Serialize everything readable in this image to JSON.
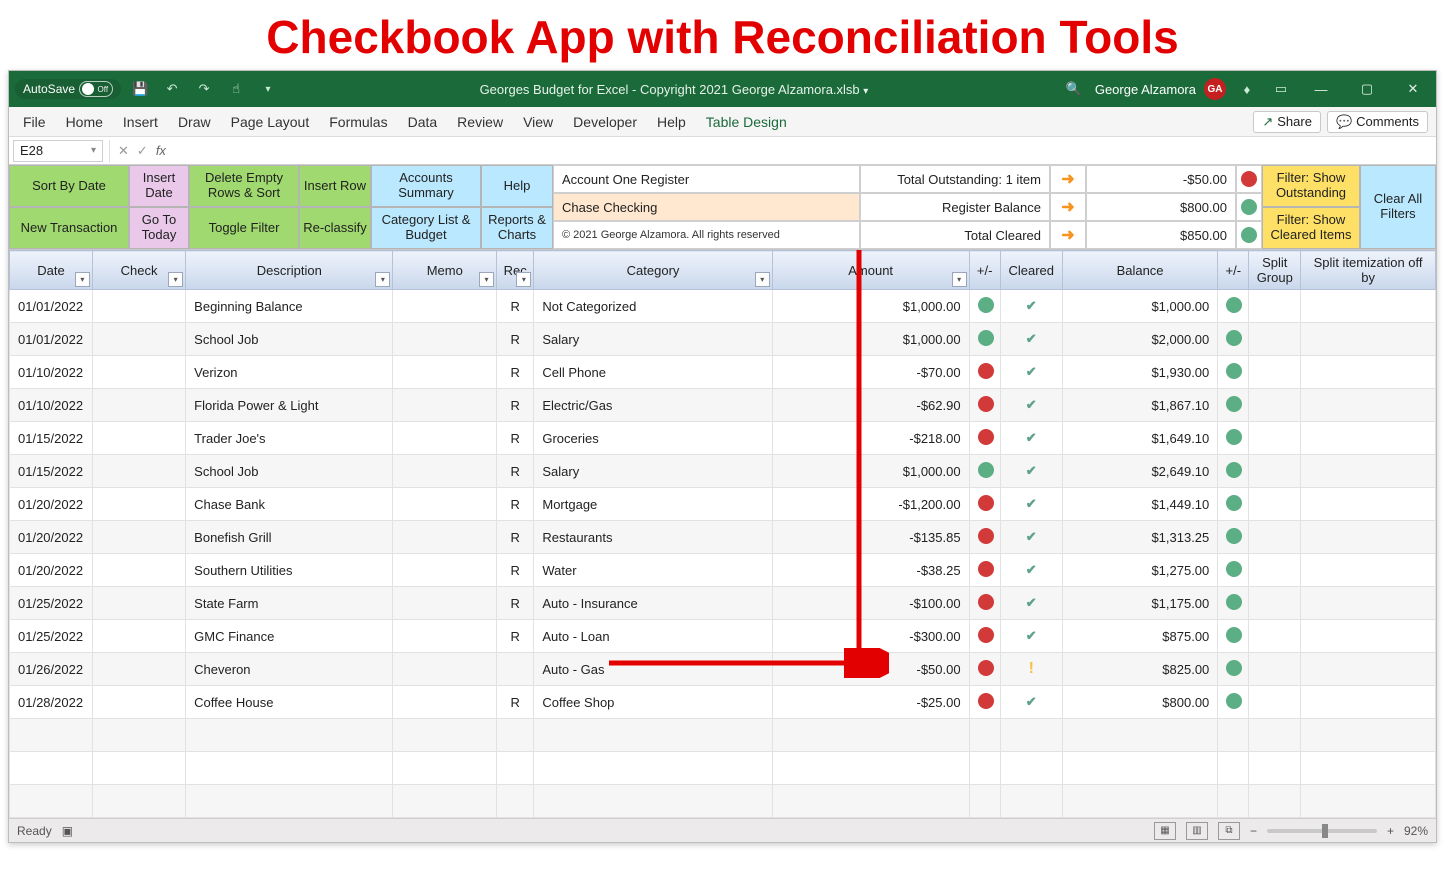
{
  "page_heading": "Checkbook App with Reconciliation Tools",
  "titlebar": {
    "autosave_label": "AutoSave",
    "autosave_state": "Off",
    "document_title": "Georges Budget for Excel - Copyright 2021 George Alzamora.xlsb",
    "user_name": "George Alzamora",
    "user_initials": "GA"
  },
  "ribbon_tabs": [
    "File",
    "Home",
    "Insert",
    "Draw",
    "Page Layout",
    "Formulas",
    "Data",
    "Review",
    "View",
    "Developer",
    "Help",
    "Table Design"
  ],
  "ribbon_active_tab": "Table Design",
  "ribbon_right": {
    "share": "Share",
    "comments": "Comments"
  },
  "formula_bar": {
    "name_box": "E28",
    "formula": ""
  },
  "macro_buttons": {
    "row1": [
      "Sort By Date",
      "Insert Date",
      "Delete Empty Rows & Sort",
      "Insert Row",
      "Accounts Summary",
      "Help"
    ],
    "row2": [
      "New Transaction",
      "Go To Today",
      "Toggle Filter",
      "Re-classify",
      "Category List & Budget",
      "Reports & Charts"
    ]
  },
  "summary_panel": {
    "row1": {
      "label": "Account One Register",
      "mid": "Total Outstanding: 1 item",
      "amount": "-$50.00",
      "dot": "red"
    },
    "row2": {
      "label": "Chase Checking",
      "mid": "Register Balance",
      "amount": "$800.00",
      "dot": "green",
      "highlight": true
    },
    "row3": {
      "label": "© 2021 George Alzamora. All rights reserved",
      "mid": "Total Cleared",
      "amount": "$850.00",
      "dot": "green"
    }
  },
  "filter_buttons": {
    "btn1": "Filter: Show Outstanding",
    "btn2": "Filter: Show Cleared Items",
    "btn3": "Clear All Filters"
  },
  "columns": [
    "Date",
    "Check",
    "Description",
    "Memo",
    "Rec",
    "Category",
    "Amount",
    "+/-",
    "Cleared",
    "Balance",
    "+/-",
    "Split Group",
    "Split itemization off by"
  ],
  "rows": [
    {
      "date": "01/01/2022",
      "check": "",
      "desc": "Beginning Balance",
      "memo": "",
      "rec": "R",
      "cat": "Not Categorized",
      "amt": "$1,000.00",
      "amt_dot": "green",
      "cleared": "check",
      "bal": "$1,000.00",
      "bal_dot": "green"
    },
    {
      "date": "01/01/2022",
      "check": "",
      "desc": "School Job",
      "memo": "",
      "rec": "R",
      "cat": "Salary",
      "amt": "$1,000.00",
      "amt_dot": "green",
      "cleared": "check",
      "bal": "$2,000.00",
      "bal_dot": "green"
    },
    {
      "date": "01/10/2022",
      "check": "",
      "desc": "Verizon",
      "memo": "",
      "rec": "R",
      "cat": "Cell Phone",
      "amt": "-$70.00",
      "amt_dot": "red",
      "cleared": "check",
      "bal": "$1,930.00",
      "bal_dot": "green"
    },
    {
      "date": "01/10/2022",
      "check": "",
      "desc": "Florida Power & Light",
      "memo": "",
      "rec": "R",
      "cat": "Electric/Gas",
      "amt": "-$62.90",
      "amt_dot": "red",
      "cleared": "check",
      "bal": "$1,867.10",
      "bal_dot": "green"
    },
    {
      "date": "01/15/2022",
      "check": "",
      "desc": "Trader Joe's",
      "memo": "",
      "rec": "R",
      "cat": "Groceries",
      "amt": "-$218.00",
      "amt_dot": "red",
      "cleared": "check",
      "bal": "$1,649.10",
      "bal_dot": "green"
    },
    {
      "date": "01/15/2022",
      "check": "",
      "desc": "School Job",
      "memo": "",
      "rec": "R",
      "cat": "Salary",
      "amt": "$1,000.00",
      "amt_dot": "green",
      "cleared": "check",
      "bal": "$2,649.10",
      "bal_dot": "green"
    },
    {
      "date": "01/20/2022",
      "check": "",
      "desc": "Chase Bank",
      "memo": "",
      "rec": "R",
      "cat": "Mortgage",
      "amt": "-$1,200.00",
      "amt_dot": "red",
      "cleared": "check",
      "bal": "$1,449.10",
      "bal_dot": "green"
    },
    {
      "date": "01/20/2022",
      "check": "",
      "desc": "Bonefish Grill",
      "memo": "",
      "rec": "R",
      "cat": "Restaurants",
      "amt": "-$135.85",
      "amt_dot": "red",
      "cleared": "check",
      "bal": "$1,313.25",
      "bal_dot": "green"
    },
    {
      "date": "01/20/2022",
      "check": "",
      "desc": "Southern Utilities",
      "memo": "",
      "rec": "R",
      "cat": "Water",
      "amt": "-$38.25",
      "amt_dot": "red",
      "cleared": "check",
      "bal": "$1,275.00",
      "bal_dot": "green"
    },
    {
      "date": "01/25/2022",
      "check": "",
      "desc": "State Farm",
      "memo": "",
      "rec": "R",
      "cat": "Auto - Insurance",
      "amt": "-$100.00",
      "amt_dot": "red",
      "cleared": "check",
      "bal": "$1,175.00",
      "bal_dot": "green"
    },
    {
      "date": "01/25/2022",
      "check": "",
      "desc": "GMC Finance",
      "memo": "",
      "rec": "R",
      "cat": "Auto - Loan",
      "amt": "-$300.00",
      "amt_dot": "red",
      "cleared": "check",
      "bal": "$875.00",
      "bal_dot": "green"
    },
    {
      "date": "01/26/2022",
      "check": "",
      "desc": "Cheveron",
      "memo": "",
      "rec": "",
      "cat": "Auto - Gas",
      "amt": "-$50.00",
      "amt_dot": "red",
      "cleared": "exclaim",
      "bal": "$825.00",
      "bal_dot": "green"
    },
    {
      "date": "01/28/2022",
      "check": "",
      "desc": "Coffee House",
      "memo": "",
      "rec": "R",
      "cat": "Coffee Shop",
      "amt": "-$25.00",
      "amt_dot": "red",
      "cleared": "check",
      "bal": "$800.00",
      "bal_dot": "green"
    }
  ],
  "statusbar": {
    "ready": "Ready",
    "zoom": "92%"
  }
}
